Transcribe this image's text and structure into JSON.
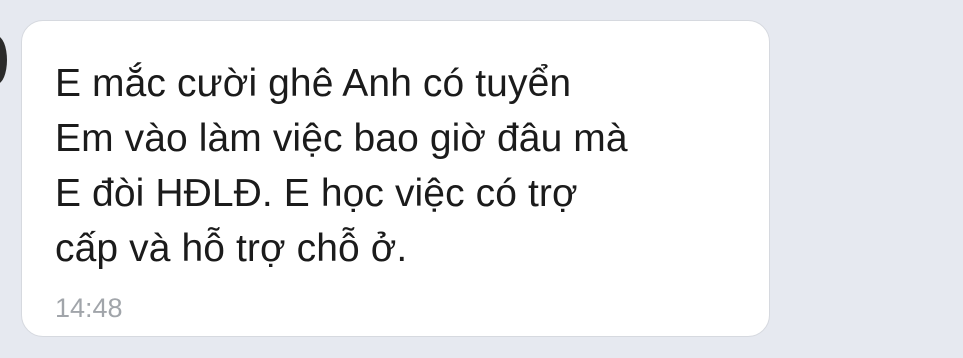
{
  "message": {
    "text": "E mắc cười ghê Anh có tuyển\nEm vào làm việc bao giờ đâu mà\nE đòi HĐLĐ. E học việc có trợ\ncấp và hỗ trợ chỗ ở.",
    "time": "14:48"
  },
  "colors": {
    "background": "#e6e9f0",
    "bubble": "#ffffff",
    "text": "#1b1b1b",
    "time": "#a1a5aa"
  }
}
